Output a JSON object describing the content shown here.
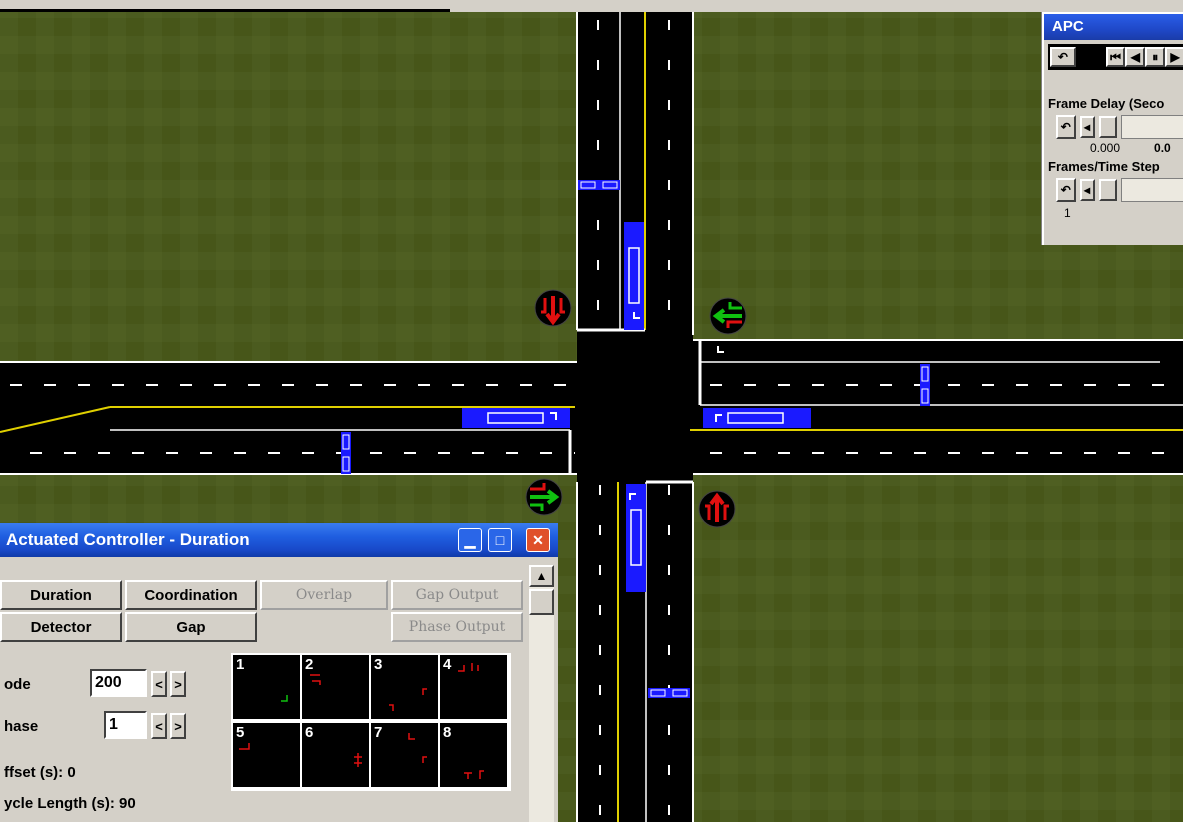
{
  "apc_panel": {
    "title": "APC",
    "frame_delay_label": "Frame Delay (Seco",
    "frame_delay_min": "0.000",
    "frame_delay_max": "0.0",
    "frames_label": "Frames/Time Step",
    "frames_min": "1"
  },
  "controller": {
    "title": "Actuated Controller - Duration",
    "tabs": {
      "duration": "Duration",
      "coordination": "Coordination",
      "overlap": "Overlap",
      "gap_output": "Gap Output",
      "detector": "Detector",
      "gap": "Gap",
      "phase_output": "Phase Output"
    },
    "node_label": "ode",
    "node_value": "200",
    "phase_label": "hase",
    "phase_value": "1",
    "offset_label": "ffset (s):  0",
    "cycle_label": "ycle Length (s): 90",
    "phases": [
      "1",
      "2",
      "3",
      "4",
      "5",
      "6",
      "7",
      "8"
    ]
  },
  "colors": {
    "grass": "#4a5a20",
    "road": "#000000",
    "detector": "#1a1aff",
    "signal_red": "#e01010",
    "signal_green": "#10c010"
  }
}
